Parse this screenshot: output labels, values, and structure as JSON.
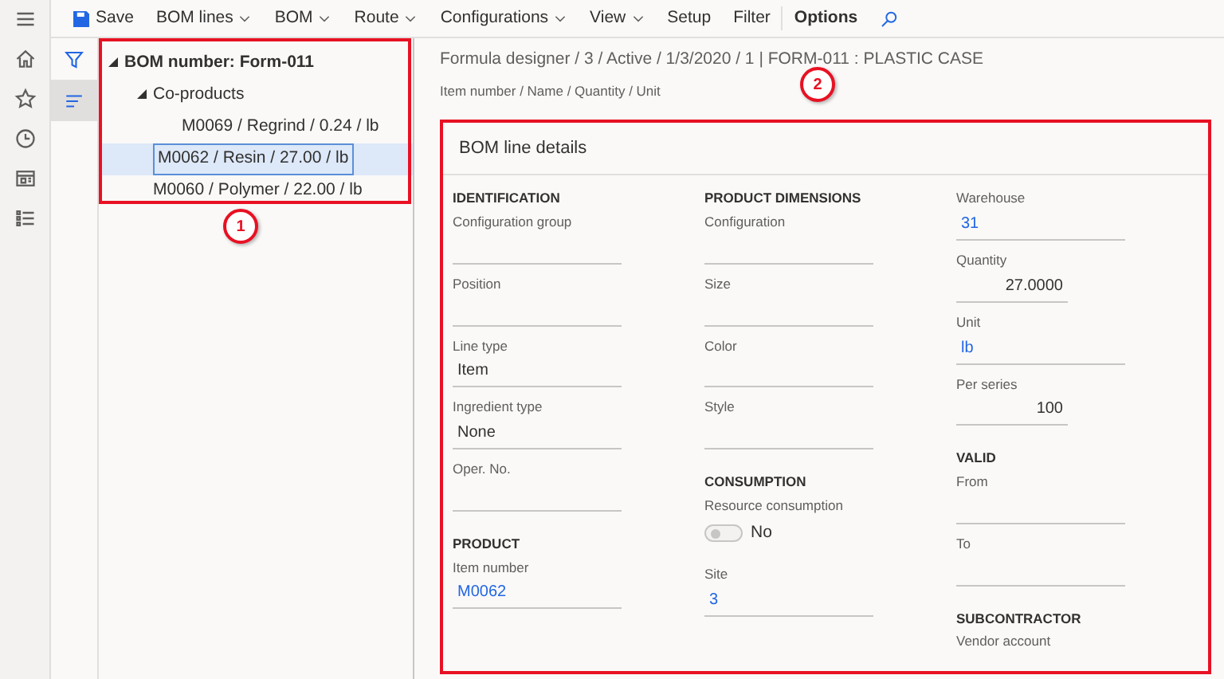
{
  "toolbar": [
    {
      "label": "Save",
      "kind": "save"
    },
    {
      "label": "BOM lines",
      "kind": "menu"
    },
    {
      "label": "BOM",
      "kind": "menu"
    },
    {
      "label": "Route",
      "kind": "menu"
    },
    {
      "label": "Configurations",
      "kind": "menu"
    },
    {
      "label": "View",
      "kind": "menu"
    },
    {
      "label": "Setup",
      "kind": "plain"
    },
    {
      "label": "Filter",
      "kind": "plain"
    },
    {
      "label": "Options",
      "kind": "bold"
    },
    {
      "kind": "search"
    }
  ],
  "nav_rail": [
    {
      "kind": "home"
    },
    {
      "kind": "star"
    },
    {
      "kind": "clock"
    },
    {
      "kind": "workspace"
    },
    {
      "kind": "list"
    }
  ],
  "side_tabs": [
    {
      "kind": "filter",
      "selected": false
    },
    {
      "kind": "lines",
      "selected": true
    }
  ],
  "tree": [
    {
      "text": "BOM number: Form-011",
      "expanded": true,
      "selected": false,
      "children": [
        {
          "text": "Co-products",
          "expanded": true,
          "selected": false,
          "children": [
            {
              "text": "M0069 / Regrind / 0.24 / lb",
              "selected": false
            }
          ]
        },
        {
          "text": "M0062 / Resin / 27.00 / lb",
          "selected": true
        },
        {
          "text": "M0060 / Polymer / 22.00 / lb",
          "selected": false
        }
      ]
    }
  ],
  "breadcrumb": "Formula designer / 3 / Active / 1/3/2020 / 1  |  FORM-011 : PLASTIC CASE",
  "breadcrumb_sub": "Item number / Name / Quantity / Unit",
  "annotations": [
    {
      "number": "1"
    },
    {
      "number": "2"
    }
  ],
  "details": {
    "title": "BOM line details",
    "columns": [
      [
        {
          "kind": "heading",
          "text": "IDENTIFICATION"
        },
        {
          "kind": "field",
          "label": "Configuration group"
        },
        {
          "kind": "field",
          "label": "Position"
        },
        {
          "kind": "field",
          "label": "Line type",
          "value": "Item",
          "link": false
        },
        {
          "kind": "field",
          "label": "Ingredient type",
          "value": "None",
          "link": false
        },
        {
          "kind": "field",
          "label": "Oper. No."
        },
        {
          "kind": "heading",
          "text": "PRODUCT"
        },
        {
          "kind": "field",
          "label": "Item number",
          "value": "M0062",
          "link": true
        }
      ],
      [
        {
          "kind": "heading",
          "text": "PRODUCT DIMENSIONS"
        },
        {
          "kind": "field",
          "label": "Configuration"
        },
        {
          "kind": "field",
          "label": "Size"
        },
        {
          "kind": "field",
          "label": "Color"
        },
        {
          "kind": "field",
          "label": "Style"
        },
        {
          "kind": "heading",
          "text": "CONSUMPTION"
        },
        {
          "kind": "toggle",
          "label": "Resource consumption",
          "value": "No",
          "on": false
        },
        {
          "kind": "field",
          "label": "Site",
          "value": "3",
          "link": true
        }
      ],
      [
        {
          "kind": "field",
          "label": "Warehouse",
          "value": "31",
          "link": true
        },
        {
          "kind": "number",
          "label": "Quantity",
          "value": "27.0000"
        },
        {
          "kind": "field",
          "label": "Unit",
          "value": "lb",
          "link": true
        },
        {
          "kind": "number",
          "label": "Per series",
          "value": "100"
        },
        {
          "kind": "heading",
          "text": "VALID"
        },
        {
          "kind": "field",
          "label": "From"
        },
        {
          "kind": "field",
          "label": "To"
        },
        {
          "kind": "heading",
          "text": "SUBCONTRACTOR"
        },
        {
          "kind": "label",
          "label": "Vendor account"
        }
      ]
    ]
  }
}
